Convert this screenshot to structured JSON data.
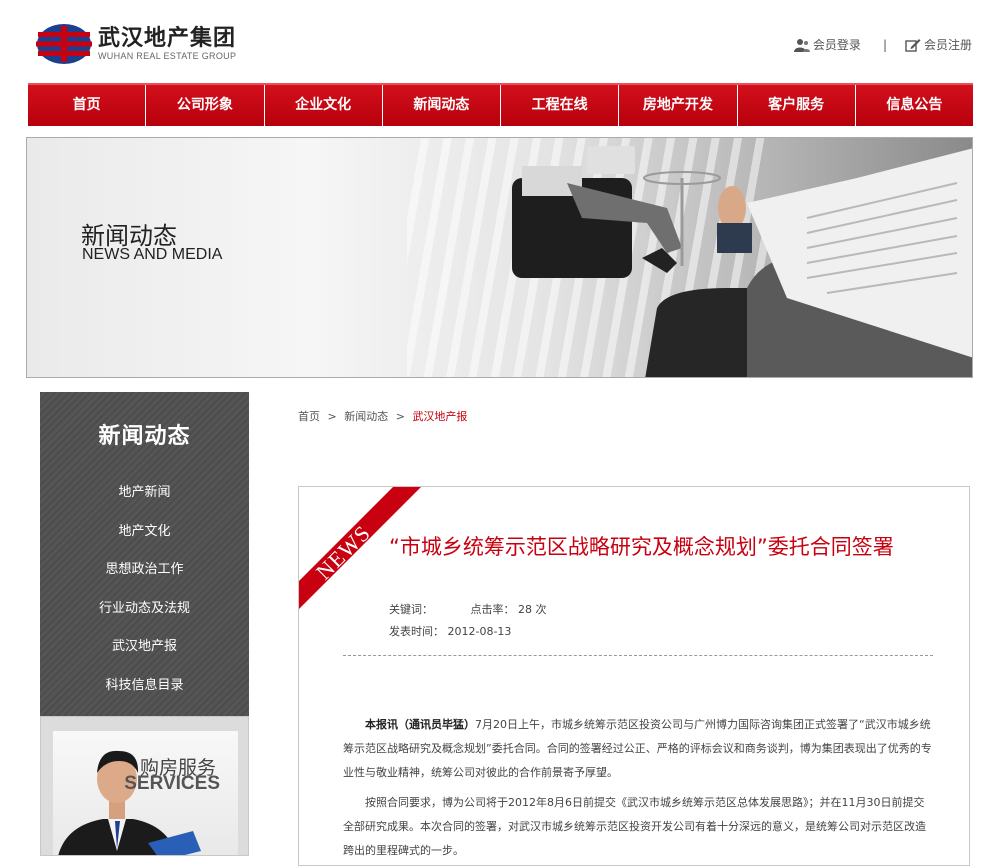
{
  "header": {
    "logo_cn": "武汉地产集团",
    "logo_en": "WUHAN REAL ESTATE GROUP",
    "login": "会员登录",
    "separator": "|",
    "register": "会员注册"
  },
  "nav": {
    "items": [
      "首页",
      "公司形象",
      "企业文化",
      "新闻动态",
      "工程在线",
      "房地产开发",
      "客户服务",
      "信息公告"
    ]
  },
  "banner": {
    "title": "新闻动态",
    "subtitle": "NEWS AND MEDIA"
  },
  "sidebar": {
    "title": "新闻动态",
    "items": [
      "地产新闻",
      "地产文化",
      "思想政治工作",
      "行业动态及法规",
      "武汉地产报",
      "科技信息目录"
    ]
  },
  "services": {
    "cn": "购房服务",
    "en": "SERVICES"
  },
  "breadcrumb": {
    "home": "首页",
    "section": "新闻动态",
    "current": "武汉地产报",
    "arrow": ">"
  },
  "article": {
    "ribbon": "NEWS",
    "title": "“市城乡统筹示范区战略研究及概念规划”委托合同签署",
    "keywords_label": "关键词：",
    "clicks_label": "点击率：",
    "clicks_value": "28 次",
    "date_label": "发表时间：",
    "date_value": "2012-08-13",
    "p1_bold": "本报讯（通讯员毕猛）",
    "p1": "7月20日上午，市城乡统筹示范区投资公司与广州博力国际咨询集团正式签署了“武汉市城乡统筹示范区战略研究及概念规划”委托合同。合同的签署经过公正、严格的评标会议和商务谈判，博为集团表现出了优秀的专业性与敬业精神，统筹公司对彼此的合作前景寄予厚望。",
    "p2": "按照合同要求，博为公司将于2012年8月6日前提交《武汉市城乡统筹示范区总体发展思路》；并在11月30日前提交全部研究成果。本次合同的签署，对武汉市城乡统筹示范区投资开发公司有着十分深远的意义，是统筹公司对示范区改造跨出的里程碑式的一步。"
  },
  "colors": {
    "brand_red": "#c8000f",
    "sidebar_gray": "#4f4f4f"
  }
}
